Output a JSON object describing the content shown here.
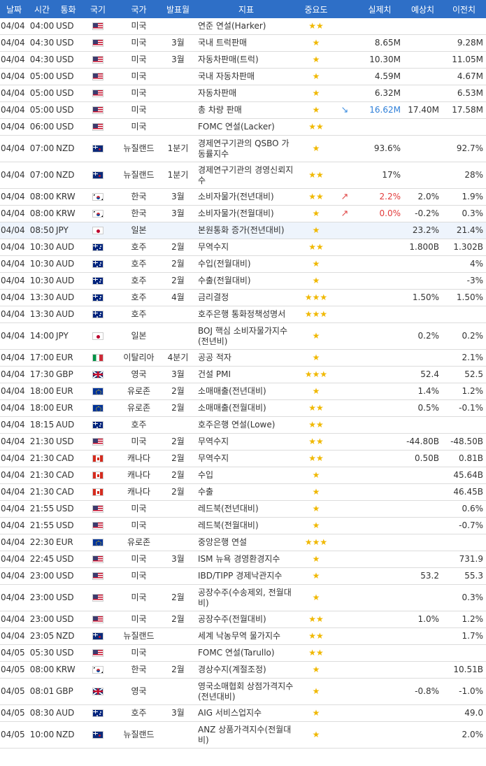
{
  "headers": [
    "날짜",
    "시간",
    "통화",
    "국기",
    "국가",
    "발표월",
    "지표",
    "중요도",
    "",
    "실제치",
    "예상치",
    "이전치"
  ],
  "rows": [
    {
      "date": "04/04",
      "time": "04:00",
      "cur": "USD",
      "flag": "us-flag-icon",
      "country": "미국",
      "month": "",
      "indicator": "연준 연설(Harker)",
      "stars": "★★",
      "arrow": "",
      "actual": "",
      "forecast": "",
      "previous": "",
      "tall": false
    },
    {
      "date": "04/04",
      "time": "04:30",
      "cur": "USD",
      "flag": "us-flag-icon",
      "country": "미국",
      "month": "3월",
      "indicator": "국내 트럭판매",
      "stars": "★",
      "arrow": "",
      "actual": "8.65M",
      "forecast": "",
      "previous": "9.28M",
      "tall": false
    },
    {
      "date": "04/04",
      "time": "04:30",
      "cur": "USD",
      "flag": "us-flag-icon",
      "country": "미국",
      "month": "3월",
      "indicator": "자동차판매(트럭)",
      "stars": "★",
      "arrow": "",
      "actual": "10.30M",
      "forecast": "",
      "previous": "11.05M",
      "tall": false
    },
    {
      "date": "04/04",
      "time": "05:00",
      "cur": "USD",
      "flag": "us-flag-icon",
      "country": "미국",
      "month": "",
      "indicator": "국내 자동차판매",
      "stars": "★",
      "arrow": "",
      "actual": "4.59M",
      "forecast": "",
      "previous": "4.67M",
      "tall": false
    },
    {
      "date": "04/04",
      "time": "05:00",
      "cur": "USD",
      "flag": "us-flag-icon",
      "country": "미국",
      "month": "",
      "indicator": "자동차판매",
      "stars": "★",
      "arrow": "",
      "actual": "6.32M",
      "forecast": "",
      "previous": "6.53M",
      "tall": false
    },
    {
      "date": "04/04",
      "time": "05:00",
      "cur": "USD",
      "flag": "us-flag-icon",
      "country": "미국",
      "month": "",
      "indicator": "총 차량 판매",
      "stars": "★",
      "arrow": "down",
      "actual": "16.62M",
      "forecast": "17.40M",
      "previous": "17.58M",
      "tall": false
    },
    {
      "date": "04/04",
      "time": "06:00",
      "cur": "USD",
      "flag": "us-flag-icon",
      "country": "미국",
      "month": "",
      "indicator": "FOMC 연설(Lacker)",
      "stars": "★★",
      "arrow": "",
      "actual": "",
      "forecast": "",
      "previous": "",
      "tall": false
    },
    {
      "date": "04/04",
      "time": "07:00",
      "cur": "NZD",
      "flag": "nz-flag-icon",
      "country": "뉴질랜드",
      "month": "1분기",
      "indicator": "경제연구기관의 QSBO 가동률지수",
      "stars": "★",
      "arrow": "",
      "actual": "93.6%",
      "forecast": "",
      "previous": "92.7%",
      "tall": true
    },
    {
      "date": "04/04",
      "time": "07:00",
      "cur": "NZD",
      "flag": "nz-flag-icon",
      "country": "뉴질랜드",
      "month": "1분기",
      "indicator": "경제연구기관의 경영신뢰지수",
      "stars": "★★",
      "arrow": "",
      "actual": "17%",
      "forecast": "",
      "previous": "28%",
      "tall": true
    },
    {
      "date": "04/04",
      "time": "08:00",
      "cur": "KRW",
      "flag": "kr-flag-icon",
      "country": "한국",
      "month": "3월",
      "indicator": "소비자물가(전년대비)",
      "stars": "★★",
      "arrow": "up",
      "actual": "2.2%",
      "forecast": "2.0%",
      "previous": "1.9%",
      "tall": false
    },
    {
      "date": "04/04",
      "time": "08:00",
      "cur": "KRW",
      "flag": "kr-flag-icon",
      "country": "한국",
      "month": "3월",
      "indicator": "소비자물가(전월대비)",
      "stars": "★",
      "arrow": "up",
      "actual": "0.0%",
      "forecast": "-0.2%",
      "previous": "0.3%",
      "tall": false
    },
    {
      "date": "04/04",
      "time": "08:50",
      "cur": "JPY",
      "flag": "jp-flag-icon",
      "country": "일본",
      "month": "",
      "indicator": "본원통화 증가(전년대비)",
      "stars": "★",
      "arrow": "",
      "actual": "",
      "forecast": "23.2%",
      "previous": "21.4%",
      "tall": false,
      "hl": true
    },
    {
      "date": "04/04",
      "time": "10:30",
      "cur": "AUD",
      "flag": "au-flag-icon",
      "country": "호주",
      "month": "2월",
      "indicator": "무역수지",
      "stars": "★★",
      "arrow": "",
      "actual": "",
      "forecast": "1.800B",
      "previous": "1.302B",
      "tall": false
    },
    {
      "date": "04/04",
      "time": "10:30",
      "cur": "AUD",
      "flag": "au-flag-icon",
      "country": "호주",
      "month": "2월",
      "indicator": "수입(전월대비)",
      "stars": "★",
      "arrow": "",
      "actual": "",
      "forecast": "",
      "previous": "4%",
      "tall": false
    },
    {
      "date": "04/04",
      "time": "10:30",
      "cur": "AUD",
      "flag": "au-flag-icon",
      "country": "호주",
      "month": "2월",
      "indicator": "수출(전월대비)",
      "stars": "★",
      "arrow": "",
      "actual": "",
      "forecast": "",
      "previous": "-3%",
      "tall": false
    },
    {
      "date": "04/04",
      "time": "13:30",
      "cur": "AUD",
      "flag": "au-flag-icon",
      "country": "호주",
      "month": "4월",
      "indicator": "금리결정",
      "stars": "★★★",
      "arrow": "",
      "actual": "",
      "forecast": "1.50%",
      "previous": "1.50%",
      "tall": false
    },
    {
      "date": "04/04",
      "time": "13:30",
      "cur": "AUD",
      "flag": "au-flag-icon",
      "country": "호주",
      "month": "",
      "indicator": "호주은행 통화정책성명서",
      "stars": "★★★",
      "arrow": "",
      "actual": "",
      "forecast": "",
      "previous": "",
      "tall": false
    },
    {
      "date": "04/04",
      "time": "14:00",
      "cur": "JPY",
      "flag": "jp-flag-icon",
      "country": "일본",
      "month": "",
      "indicator": "BOJ 핵심 소비자물가지수(전년비)",
      "stars": "★",
      "arrow": "",
      "actual": "",
      "forecast": "0.2%",
      "previous": "0.2%",
      "tall": true
    },
    {
      "date": "04/04",
      "time": "17:00",
      "cur": "EUR",
      "flag": "it-flag-icon",
      "country": "이탈리아",
      "month": "4분기",
      "indicator": "공공 적자",
      "stars": "★",
      "arrow": "",
      "actual": "",
      "forecast": "",
      "previous": "2.1%",
      "tall": false
    },
    {
      "date": "04/04",
      "time": "17:30",
      "cur": "GBP",
      "flag": "gb-flag-icon",
      "country": "영국",
      "month": "3월",
      "indicator": "건설 PMI",
      "stars": "★★★",
      "arrow": "",
      "actual": "",
      "forecast": "52.4",
      "previous": "52.5",
      "tall": false
    },
    {
      "date": "04/04",
      "time": "18:00",
      "cur": "EUR",
      "flag": "eu-flag-icon",
      "country": "유로존",
      "month": "2월",
      "indicator": "소매매출(전년대비)",
      "stars": "★",
      "arrow": "",
      "actual": "",
      "forecast": "1.4%",
      "previous": "1.2%",
      "tall": false
    },
    {
      "date": "04/04",
      "time": "18:00",
      "cur": "EUR",
      "flag": "eu-flag-icon",
      "country": "유로존",
      "month": "2월",
      "indicator": "소매매출(전월대비)",
      "stars": "★★",
      "arrow": "",
      "actual": "",
      "forecast": "0.5%",
      "previous": "-0.1%",
      "tall": false
    },
    {
      "date": "04/04",
      "time": "18:15",
      "cur": "AUD",
      "flag": "au-flag-icon",
      "country": "호주",
      "month": "",
      "indicator": "호주은행 연설(Lowe)",
      "stars": "★★",
      "arrow": "",
      "actual": "",
      "forecast": "",
      "previous": "",
      "tall": false
    },
    {
      "date": "04/04",
      "time": "21:30",
      "cur": "USD",
      "flag": "us-flag-icon",
      "country": "미국",
      "month": "2월",
      "indicator": "무역수지",
      "stars": "★★",
      "arrow": "",
      "actual": "",
      "forecast": "-44.80B",
      "previous": "-48.50B",
      "tall": false
    },
    {
      "date": "04/04",
      "time": "21:30",
      "cur": "CAD",
      "flag": "ca-flag-icon",
      "country": "캐나다",
      "month": "2월",
      "indicator": "무역수지",
      "stars": "★★",
      "arrow": "",
      "actual": "",
      "forecast": "0.50B",
      "previous": "0.81B",
      "tall": false
    },
    {
      "date": "04/04",
      "time": "21:30",
      "cur": "CAD",
      "flag": "ca-flag-icon",
      "country": "캐나다",
      "month": "2월",
      "indicator": "수입",
      "stars": "★",
      "arrow": "",
      "actual": "",
      "forecast": "",
      "previous": "45.64B",
      "tall": false
    },
    {
      "date": "04/04",
      "time": "21:30",
      "cur": "CAD",
      "flag": "ca-flag-icon",
      "country": "캐나다",
      "month": "2월",
      "indicator": "수출",
      "stars": "★",
      "arrow": "",
      "actual": "",
      "forecast": "",
      "previous": "46.45B",
      "tall": false
    },
    {
      "date": "04/04",
      "time": "21:55",
      "cur": "USD",
      "flag": "us-flag-icon",
      "country": "미국",
      "month": "",
      "indicator": "레드북(전년대비)",
      "stars": "★",
      "arrow": "",
      "actual": "",
      "forecast": "",
      "previous": "0.6%",
      "tall": false
    },
    {
      "date": "04/04",
      "time": "21:55",
      "cur": "USD",
      "flag": "us-flag-icon",
      "country": "미국",
      "month": "",
      "indicator": "레드북(전월대비)",
      "stars": "★",
      "arrow": "",
      "actual": "",
      "forecast": "",
      "previous": "-0.7%",
      "tall": false
    },
    {
      "date": "04/04",
      "time": "22:30",
      "cur": "EUR",
      "flag": "eu-flag-icon",
      "country": "유로존",
      "month": "",
      "indicator": "중앙은행 연설",
      "stars": "★★★",
      "arrow": "",
      "actual": "",
      "forecast": "",
      "previous": "",
      "tall": false
    },
    {
      "date": "04/04",
      "time": "22:45",
      "cur": "USD",
      "flag": "us-flag-icon",
      "country": "미국",
      "month": "3월",
      "indicator": "ISM 뉴욕 경영환경지수",
      "stars": "★",
      "arrow": "",
      "actual": "",
      "forecast": "",
      "previous": "731.9",
      "tall": false
    },
    {
      "date": "04/04",
      "time": "23:00",
      "cur": "USD",
      "flag": "us-flag-icon",
      "country": "미국",
      "month": "",
      "indicator": "IBD/TIPP 경제낙관지수",
      "stars": "★",
      "arrow": "",
      "actual": "",
      "forecast": "53.2",
      "previous": "55.3",
      "tall": false
    },
    {
      "date": "04/04",
      "time": "23:00",
      "cur": "USD",
      "flag": "us-flag-icon",
      "country": "미국",
      "month": "2월",
      "indicator": "공장수주(수송제외, 전월대비)",
      "stars": "★",
      "arrow": "",
      "actual": "",
      "forecast": "",
      "previous": "0.3%",
      "tall": true
    },
    {
      "date": "04/04",
      "time": "23:00",
      "cur": "USD",
      "flag": "us-flag-icon",
      "country": "미국",
      "month": "2월",
      "indicator": "공장수주(전월대비)",
      "stars": "★★",
      "arrow": "",
      "actual": "",
      "forecast": "1.0%",
      "previous": "1.2%",
      "tall": false
    },
    {
      "date": "04/04",
      "time": "23:05",
      "cur": "NZD",
      "flag": "nz-flag-icon",
      "country": "뉴질랜드",
      "month": "",
      "indicator": "세계 낙농무역 물가지수",
      "stars": "★★",
      "arrow": "",
      "actual": "",
      "forecast": "",
      "previous": "1.7%",
      "tall": false
    },
    {
      "date": "04/05",
      "time": "05:30",
      "cur": "USD",
      "flag": "us-flag-icon",
      "country": "미국",
      "month": "",
      "indicator": "FOMC 연설(Tarullo)",
      "stars": "★★",
      "arrow": "",
      "actual": "",
      "forecast": "",
      "previous": "",
      "tall": false
    },
    {
      "date": "04/05",
      "time": "08:00",
      "cur": "KRW",
      "flag": "kr-flag-icon",
      "country": "한국",
      "month": "2월",
      "indicator": "경상수지(계절조정)",
      "stars": "★",
      "arrow": "",
      "actual": "",
      "forecast": "",
      "previous": "10.51B",
      "tall": false
    },
    {
      "date": "04/05",
      "time": "08:01",
      "cur": "GBP",
      "flag": "gb-flag-icon",
      "country": "영국",
      "month": "",
      "indicator": "영국소매협회 상점가격지수(전년대비)",
      "stars": "★",
      "arrow": "",
      "actual": "",
      "forecast": "-0.8%",
      "previous": "-1.0%",
      "tall": true
    },
    {
      "date": "04/05",
      "time": "08:30",
      "cur": "AUD",
      "flag": "au-flag-icon",
      "country": "호주",
      "month": "3월",
      "indicator": "AIG 서비스업지수",
      "stars": "★",
      "arrow": "",
      "actual": "",
      "forecast": "",
      "previous": "49.0",
      "tall": false
    },
    {
      "date": "04/05",
      "time": "10:00",
      "cur": "NZD",
      "flag": "nz-flag-icon",
      "country": "뉴질랜드",
      "month": "",
      "indicator": "ANZ 상품가격지수(전월대비)",
      "stars": "★",
      "arrow": "",
      "actual": "",
      "forecast": "",
      "previous": "2.0%",
      "tall": true
    }
  ]
}
